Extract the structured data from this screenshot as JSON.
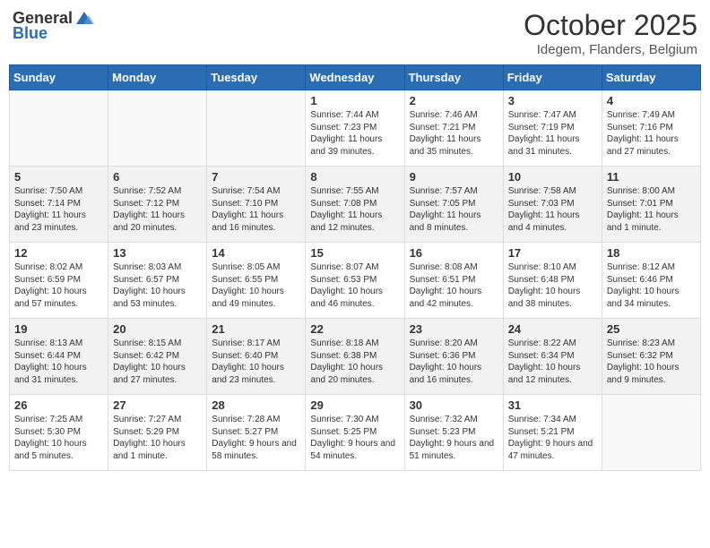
{
  "header": {
    "logo_general": "General",
    "logo_blue": "Blue",
    "month_title": "October 2025",
    "subtitle": "Idegem, Flanders, Belgium"
  },
  "weekdays": [
    "Sunday",
    "Monday",
    "Tuesday",
    "Wednesday",
    "Thursday",
    "Friday",
    "Saturday"
  ],
  "weeks": [
    [
      {
        "day": "",
        "info": ""
      },
      {
        "day": "",
        "info": ""
      },
      {
        "day": "",
        "info": ""
      },
      {
        "day": "1",
        "info": "Sunrise: 7:44 AM\nSunset: 7:23 PM\nDaylight: 11 hours\nand 39 minutes."
      },
      {
        "day": "2",
        "info": "Sunrise: 7:46 AM\nSunset: 7:21 PM\nDaylight: 11 hours\nand 35 minutes."
      },
      {
        "day": "3",
        "info": "Sunrise: 7:47 AM\nSunset: 7:19 PM\nDaylight: 11 hours\nand 31 minutes."
      },
      {
        "day": "4",
        "info": "Sunrise: 7:49 AM\nSunset: 7:16 PM\nDaylight: 11 hours\nand 27 minutes."
      }
    ],
    [
      {
        "day": "5",
        "info": "Sunrise: 7:50 AM\nSunset: 7:14 PM\nDaylight: 11 hours\nand 23 minutes."
      },
      {
        "day": "6",
        "info": "Sunrise: 7:52 AM\nSunset: 7:12 PM\nDaylight: 11 hours\nand 20 minutes."
      },
      {
        "day": "7",
        "info": "Sunrise: 7:54 AM\nSunset: 7:10 PM\nDaylight: 11 hours\nand 16 minutes."
      },
      {
        "day": "8",
        "info": "Sunrise: 7:55 AM\nSunset: 7:08 PM\nDaylight: 11 hours\nand 12 minutes."
      },
      {
        "day": "9",
        "info": "Sunrise: 7:57 AM\nSunset: 7:05 PM\nDaylight: 11 hours\nand 8 minutes."
      },
      {
        "day": "10",
        "info": "Sunrise: 7:58 AM\nSunset: 7:03 PM\nDaylight: 11 hours\nand 4 minutes."
      },
      {
        "day": "11",
        "info": "Sunrise: 8:00 AM\nSunset: 7:01 PM\nDaylight: 11 hours\nand 1 minute."
      }
    ],
    [
      {
        "day": "12",
        "info": "Sunrise: 8:02 AM\nSunset: 6:59 PM\nDaylight: 10 hours\nand 57 minutes."
      },
      {
        "day": "13",
        "info": "Sunrise: 8:03 AM\nSunset: 6:57 PM\nDaylight: 10 hours\nand 53 minutes."
      },
      {
        "day": "14",
        "info": "Sunrise: 8:05 AM\nSunset: 6:55 PM\nDaylight: 10 hours\nand 49 minutes."
      },
      {
        "day": "15",
        "info": "Sunrise: 8:07 AM\nSunset: 6:53 PM\nDaylight: 10 hours\nand 46 minutes."
      },
      {
        "day": "16",
        "info": "Sunrise: 8:08 AM\nSunset: 6:51 PM\nDaylight: 10 hours\nand 42 minutes."
      },
      {
        "day": "17",
        "info": "Sunrise: 8:10 AM\nSunset: 6:48 PM\nDaylight: 10 hours\nand 38 minutes."
      },
      {
        "day": "18",
        "info": "Sunrise: 8:12 AM\nSunset: 6:46 PM\nDaylight: 10 hours\nand 34 minutes."
      }
    ],
    [
      {
        "day": "19",
        "info": "Sunrise: 8:13 AM\nSunset: 6:44 PM\nDaylight: 10 hours\nand 31 minutes."
      },
      {
        "day": "20",
        "info": "Sunrise: 8:15 AM\nSunset: 6:42 PM\nDaylight: 10 hours\nand 27 minutes."
      },
      {
        "day": "21",
        "info": "Sunrise: 8:17 AM\nSunset: 6:40 PM\nDaylight: 10 hours\nand 23 minutes."
      },
      {
        "day": "22",
        "info": "Sunrise: 8:18 AM\nSunset: 6:38 PM\nDaylight: 10 hours\nand 20 minutes."
      },
      {
        "day": "23",
        "info": "Sunrise: 8:20 AM\nSunset: 6:36 PM\nDaylight: 10 hours\nand 16 minutes."
      },
      {
        "day": "24",
        "info": "Sunrise: 8:22 AM\nSunset: 6:34 PM\nDaylight: 10 hours\nand 12 minutes."
      },
      {
        "day": "25",
        "info": "Sunrise: 8:23 AM\nSunset: 6:32 PM\nDaylight: 10 hours\nand 9 minutes."
      }
    ],
    [
      {
        "day": "26",
        "info": "Sunrise: 7:25 AM\nSunset: 5:30 PM\nDaylight: 10 hours\nand 5 minutes."
      },
      {
        "day": "27",
        "info": "Sunrise: 7:27 AM\nSunset: 5:29 PM\nDaylight: 10 hours\nand 1 minute."
      },
      {
        "day": "28",
        "info": "Sunrise: 7:28 AM\nSunset: 5:27 PM\nDaylight: 9 hours\nand 58 minutes."
      },
      {
        "day": "29",
        "info": "Sunrise: 7:30 AM\nSunset: 5:25 PM\nDaylight: 9 hours\nand 54 minutes."
      },
      {
        "day": "30",
        "info": "Sunrise: 7:32 AM\nSunset: 5:23 PM\nDaylight: 9 hours\nand 51 minutes."
      },
      {
        "day": "31",
        "info": "Sunrise: 7:34 AM\nSunset: 5:21 PM\nDaylight: 9 hours\nand 47 minutes."
      },
      {
        "day": "",
        "info": ""
      }
    ]
  ]
}
